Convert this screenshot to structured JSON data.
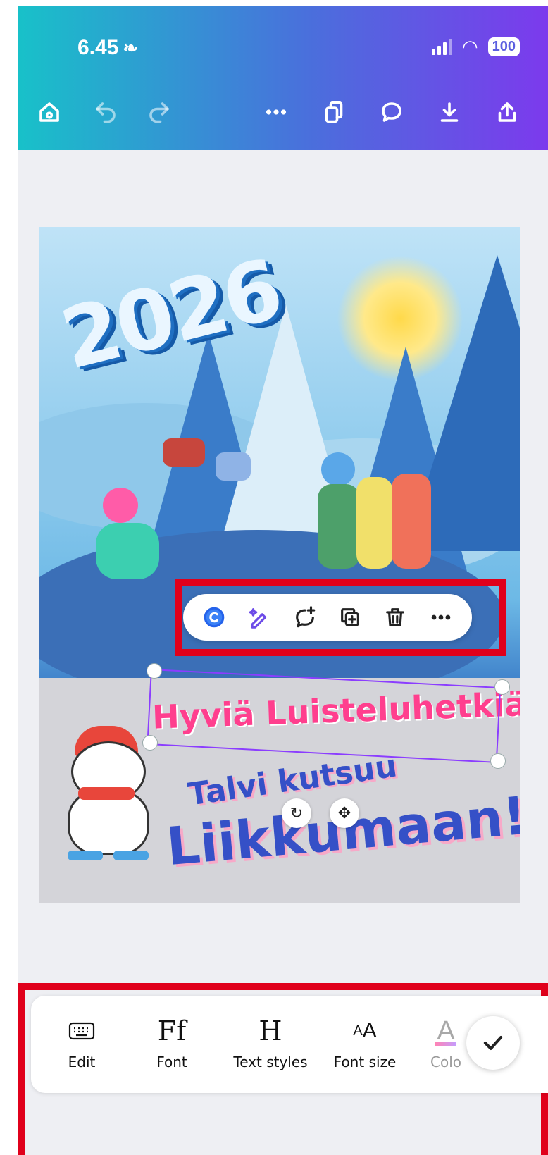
{
  "status_bar": {
    "time": "6.45",
    "battery": "100"
  },
  "design": {
    "year_text": "2026",
    "headline_1": "Hyviä Luisteluhetkiä",
    "headline_2": "Talvi kutsuu",
    "headline_3": "Liikkumaan!"
  },
  "text_toolbar": {
    "items": [
      {
        "label": "Edit",
        "icon": "keyboard-icon"
      },
      {
        "label": "Font",
        "icon": "font-icon"
      },
      {
        "label": "Text styles",
        "icon": "text-styles-icon"
      },
      {
        "label": "Font size",
        "icon": "font-size-icon"
      },
      {
        "label": "Colo",
        "icon": "color-icon"
      }
    ]
  },
  "colors": {
    "accent": "#8b3dff",
    "highlight": "#e0001b",
    "pink_text": "#ff3f8e",
    "blue_text": "#3550c7"
  }
}
